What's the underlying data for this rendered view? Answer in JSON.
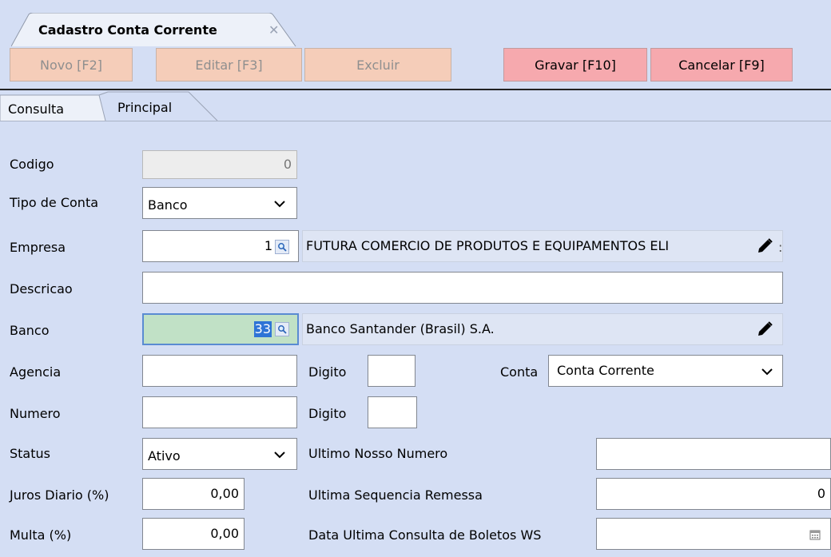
{
  "window_tab": {
    "title": "Cadastro Conta Corrente",
    "close_glyph": "✕"
  },
  "toolbar": {
    "novo": "Novo [F2]",
    "editar": "Editar [F3]",
    "excluir": "Excluir",
    "gravar": "Gravar [F10]",
    "cancelar": "Cancelar [F9]"
  },
  "tabs": {
    "consulta": "Consulta",
    "principal": "Principal"
  },
  "form": {
    "codigo": {
      "label": "Codigo",
      "value": "0"
    },
    "tipo_conta": {
      "label": "Tipo de Conta",
      "value": "Banco"
    },
    "empresa": {
      "label": "Empresa",
      "code": "1",
      "description": "FUTURA COMERCIO DE PRODUTOS E EQUIPAMENTOS ELI"
    },
    "descricao": {
      "label": "Descricao",
      "value": ""
    },
    "banco": {
      "label": "Banco",
      "code": "33",
      "description": "Banco Santander (Brasil) S.A."
    },
    "agencia": {
      "label": "Agencia",
      "value": "",
      "digito_label": "Digito",
      "digito_value": ""
    },
    "conta": {
      "label": "Conta",
      "value": "Conta Corrente"
    },
    "numero": {
      "label": "Numero",
      "value": "",
      "digito_label": "Digito",
      "digito_value": ""
    },
    "status": {
      "label": "Status",
      "value": "Ativo"
    },
    "ultimo_nosso_numero": {
      "label": "Ultimo Nosso Numero",
      "value": ""
    },
    "juros_diario": {
      "label": "Juros Diario (%)",
      "value": "0,00"
    },
    "ultima_sequencia_remessa": {
      "label": "Ultima Sequencia Remessa",
      "value": "0"
    },
    "multa": {
      "label": "Multa (%)",
      "value": "0,00"
    },
    "data_ultima_consulta": {
      "label": "Data Ultima Consulta de Boletos WS",
      "value": ""
    }
  },
  "icons": {
    "lookup": "magnifier-icon",
    "edit": "pencil-icon",
    "dropdown": "chevron-down-icon",
    "calendar": "calendar-icon"
  },
  "colors": {
    "background": "#d4def4",
    "disabled_button": "#f5cdb9",
    "active_button": "#f6a9ae",
    "focused_field": "#c1e1c6",
    "selection": "#2e74d6"
  }
}
